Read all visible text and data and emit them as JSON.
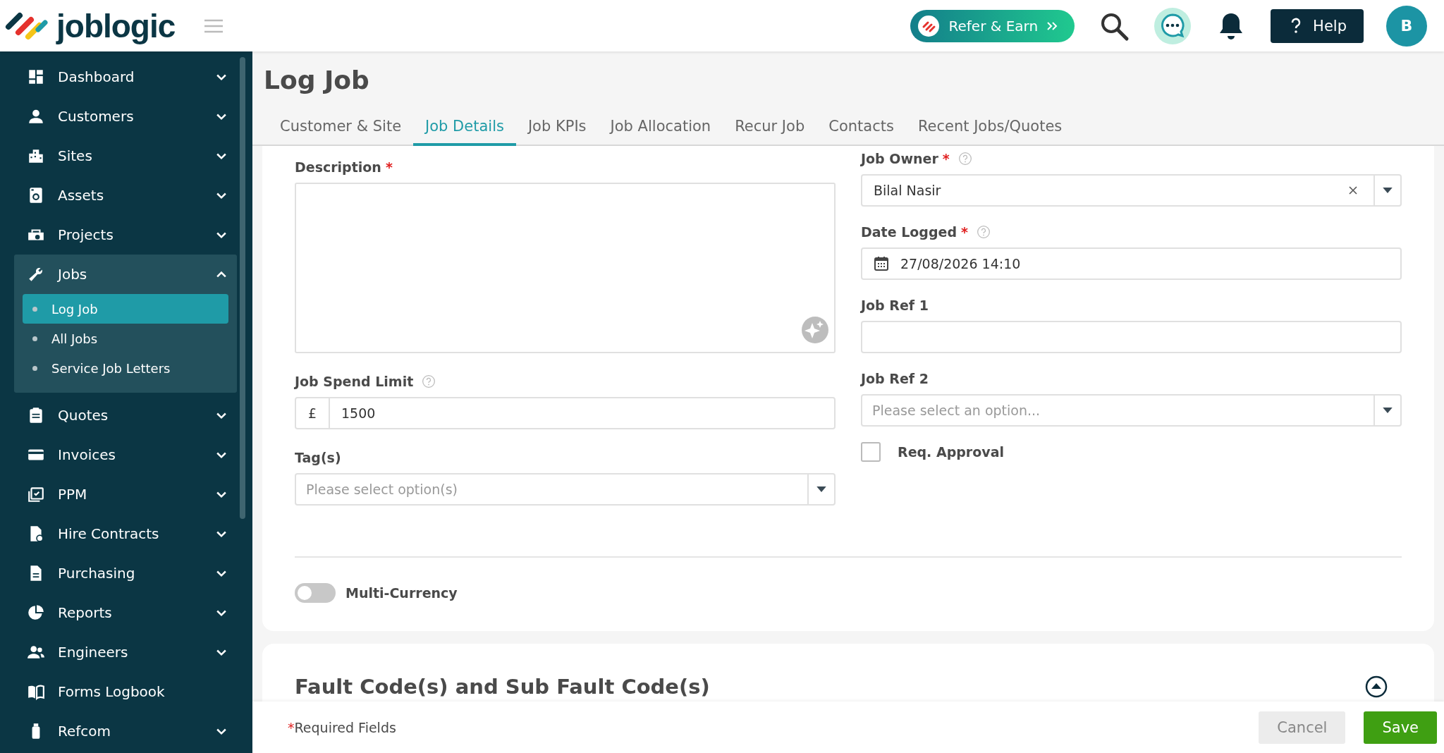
{
  "header": {
    "logo": "joblogic",
    "refer_button": "Refer & Earn",
    "help_button": "Help",
    "avatar": "B"
  },
  "sidebar": {
    "items": [
      {
        "label": "Dashboard",
        "kind": "group",
        "expanded": false
      },
      {
        "label": "Customers",
        "kind": "group",
        "expanded": false
      },
      {
        "label": "Sites",
        "kind": "group",
        "expanded": false
      },
      {
        "label": "Assets",
        "kind": "group",
        "expanded": false
      },
      {
        "label": "Projects",
        "kind": "group",
        "expanded": false
      },
      {
        "label": "Jobs",
        "kind": "group",
        "expanded": true,
        "children": [
          {
            "label": "Log Job",
            "selected": true
          },
          {
            "label": "All Jobs",
            "selected": false
          },
          {
            "label": "Service Job Letters",
            "selected": false
          }
        ]
      },
      {
        "label": "Quotes",
        "kind": "group",
        "expanded": false
      },
      {
        "label": "Invoices",
        "kind": "group",
        "expanded": false
      },
      {
        "label": "PPM",
        "kind": "group",
        "expanded": false
      },
      {
        "label": "Hire Contracts",
        "kind": "group",
        "expanded": false
      },
      {
        "label": "Purchasing",
        "kind": "group",
        "expanded": false
      },
      {
        "label": "Reports",
        "kind": "group",
        "expanded": false
      },
      {
        "label": "Engineers",
        "kind": "group",
        "expanded": false
      },
      {
        "label": "Forms Logbook",
        "kind": "link"
      },
      {
        "label": "Refcom",
        "kind": "group",
        "expanded": false
      }
    ]
  },
  "page": {
    "title": "Log Job"
  },
  "tabs": [
    {
      "label": "Customer & Site",
      "selected": false
    },
    {
      "label": "Job Details",
      "selected": true
    },
    {
      "label": "Job KPIs",
      "selected": false
    },
    {
      "label": "Job Allocation",
      "selected": false
    },
    {
      "label": "Recur Job",
      "selected": false
    },
    {
      "label": "Contacts",
      "selected": false
    },
    {
      "label": "Recent Jobs/Quotes",
      "selected": false
    }
  ],
  "form": {
    "left": [
      {
        "kind": "textarea",
        "label": "Description",
        "required_mark": "*"
      },
      {
        "kind": "currency",
        "label": "Job Spend Limit",
        "help": true,
        "prefix": "£",
        "value": "1500"
      },
      {
        "kind": "select",
        "label": "Tag(s)",
        "placeholder": "Please select option(s)"
      }
    ],
    "right": [
      {
        "kind": "select",
        "label": "Job Owner",
        "required_mark": "*",
        "help": true,
        "value": "Bilal Nasir",
        "clearable": true
      },
      {
        "kind": "date",
        "label": "Date Logged",
        "required_mark": "*",
        "help": true,
        "value": "27/08/2026 14:10"
      },
      {
        "kind": "text",
        "label": "Job Ref 1"
      },
      {
        "kind": "select",
        "label": "Job Ref 2",
        "placeholder": "Please select an option..."
      },
      {
        "kind": "checkbox",
        "label": "Req. Approval",
        "checked": false
      }
    ],
    "multi_currency": {
      "label": "Multi-Currency",
      "on": false
    }
  },
  "fault_section": {
    "title": "Fault Code(s) and Sub Fault Code(s)"
  },
  "footer": {
    "required_mark": "*",
    "required_note": "Required Fields",
    "buttons": [
      {
        "label": "Cancel",
        "kind": "secondary"
      },
      {
        "label": "Save",
        "kind": "primary"
      }
    ]
  }
}
